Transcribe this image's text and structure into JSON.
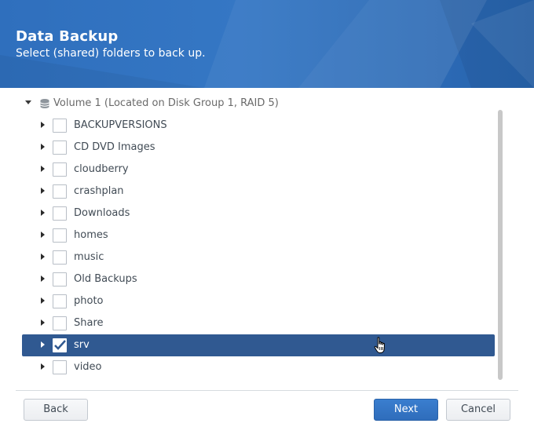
{
  "header": {
    "title": "Data Backup",
    "subtitle": "Select (shared) folders to back up."
  },
  "tree": {
    "volume_label": "Volume 1 (Located on Disk Group 1, RAID 5)",
    "items": [
      {
        "label": "BACKUPVERSIONS",
        "checked": false,
        "selected": false
      },
      {
        "label": "CD DVD Images",
        "checked": false,
        "selected": false
      },
      {
        "label": "cloudberry",
        "checked": false,
        "selected": false
      },
      {
        "label": "crashplan",
        "checked": false,
        "selected": false
      },
      {
        "label": "Downloads",
        "checked": false,
        "selected": false
      },
      {
        "label": "homes",
        "checked": false,
        "selected": false
      },
      {
        "label": "music",
        "checked": false,
        "selected": false
      },
      {
        "label": "Old Backups",
        "checked": false,
        "selected": false
      },
      {
        "label": "photo",
        "checked": false,
        "selected": false
      },
      {
        "label": "Share",
        "checked": false,
        "selected": false
      },
      {
        "label": "srv",
        "checked": true,
        "selected": true
      },
      {
        "label": "video",
        "checked": false,
        "selected": false
      }
    ]
  },
  "footer": {
    "back_label": "Back",
    "next_label": "Next",
    "cancel_label": "Cancel"
  },
  "colors": {
    "header_blue": "#2f6fbd",
    "selection": "#305991",
    "primary_button": "#3577c6"
  },
  "icons": {
    "volume": "database-icon",
    "expand": "triangle-right-icon",
    "collapse": "triangle-down-icon",
    "cursor": "hand-pointer-icon"
  }
}
